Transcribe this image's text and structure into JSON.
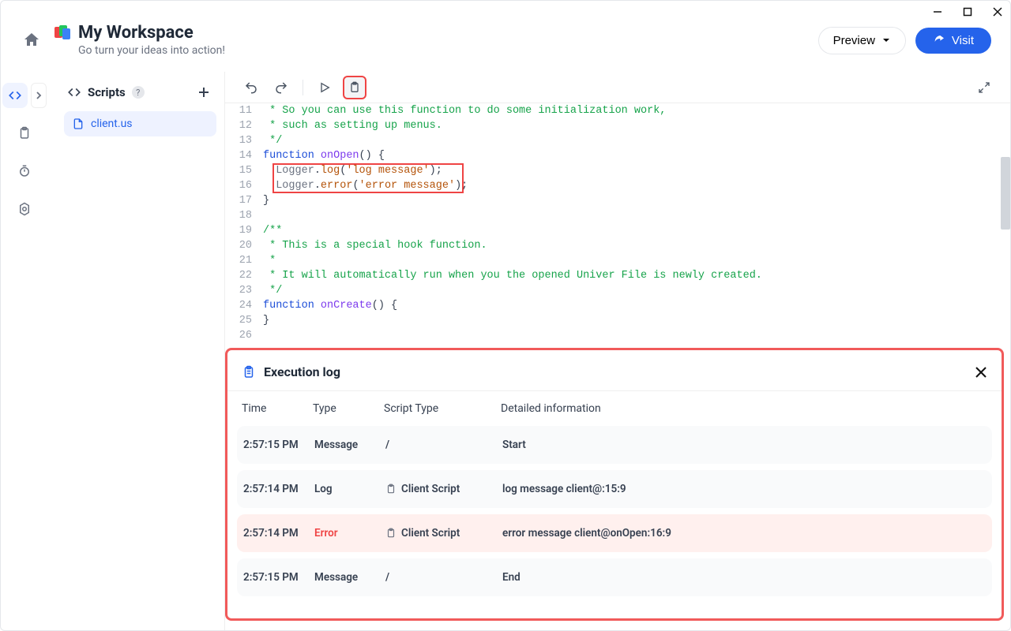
{
  "window": {
    "minimize": "—",
    "maximize": "▢",
    "close": "✕"
  },
  "header": {
    "title": "My Workspace",
    "subtitle": "Go turn your ideas into action!",
    "preview_label": "Preview",
    "visit_label": "Visit"
  },
  "sidebar": {
    "scripts_label": "Scripts",
    "file_name": "client.us"
  },
  "editor": {
    "lines": [
      {
        "n": 11,
        "html": " <span class='c-cmt'>* So you can use this function to do some initialization work,</span>"
      },
      {
        "n": 12,
        "html": " <span class='c-cmt'>* such as setting up menus.</span>"
      },
      {
        "n": 13,
        "html": " <span class='c-cmt'>*/</span>"
      },
      {
        "n": 14,
        "html": "<span class='c-kw'>function</span> <span class='c-name'>onOpen</span><span class='c-punc'>() {</span>"
      },
      {
        "n": 15,
        "html": "  <span class='c-fn'>Logger</span>.<span class='c-call'>log</span>(<span class='c-str'>'log message'</span>);"
      },
      {
        "n": 16,
        "html": "  <span class='c-fn'>Logger</span>.<span class='c-call'>error</span>(<span class='c-str'>'error message'</span>);"
      },
      {
        "n": 17,
        "html": "<span class='c-punc'>}</span>"
      },
      {
        "n": 18,
        "html": ""
      },
      {
        "n": 19,
        "html": "<span class='c-cmt'>/**</span>"
      },
      {
        "n": 20,
        "html": " <span class='c-cmt'>* This is a special hook function.</span>"
      },
      {
        "n": 21,
        "html": " <span class='c-cmt'>*</span>"
      },
      {
        "n": 22,
        "html": " <span class='c-cmt'>* It will automatically run when you the opened Univer File is newly created.</span>"
      },
      {
        "n": 23,
        "html": " <span class='c-cmt'>*/</span>"
      },
      {
        "n": 24,
        "html": "<span class='c-kw'>function</span> <span class='c-name'>onCreate</span><span class='c-punc'>() {</span>"
      },
      {
        "n": 25,
        "html": "<span class='c-punc'>}</span>"
      },
      {
        "n": 26,
        "html": ""
      }
    ]
  },
  "exec_log": {
    "title": "Execution log",
    "columns": {
      "time": "Time",
      "type": "Type",
      "script": "Script Type",
      "detail": "Detailed information"
    },
    "rows": [
      {
        "time": "2:57:15 PM",
        "type": "Message",
        "script": "/",
        "detail": "Start",
        "kind": "msg"
      },
      {
        "time": "2:57:14 PM",
        "type": "Log",
        "script": "Client Script",
        "detail": "log message client@:15:9",
        "kind": "log"
      },
      {
        "time": "2:57:14 PM",
        "type": "Error",
        "script": "Client Script",
        "detail": "error message client@onOpen:16:9",
        "kind": "error"
      },
      {
        "time": "2:57:15 PM",
        "type": "Message",
        "script": "/",
        "detail": "End",
        "kind": "msg"
      }
    ]
  }
}
